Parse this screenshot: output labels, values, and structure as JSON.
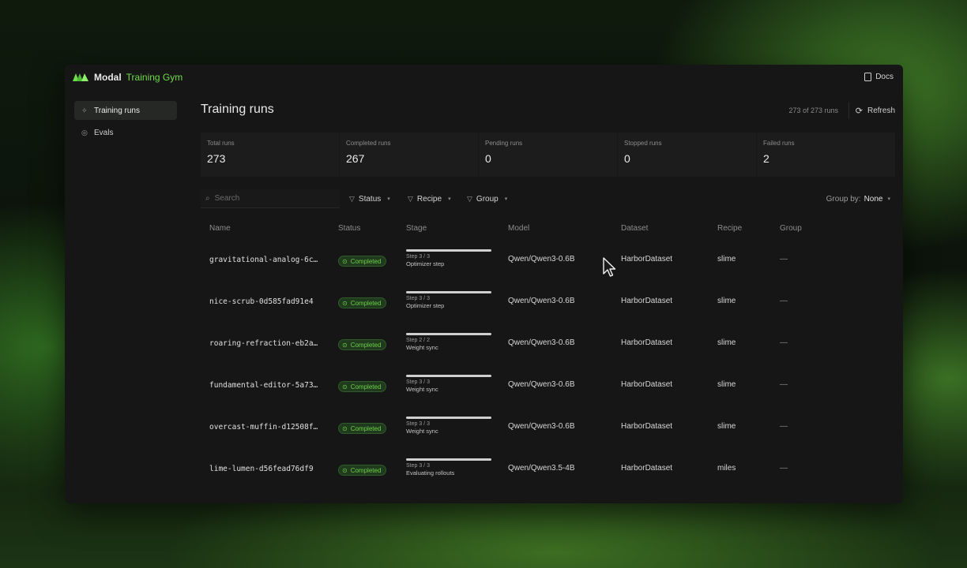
{
  "app": {
    "brand_primary": "Modal",
    "brand_secondary": "Training Gym",
    "accent_color": "#6fdc4a",
    "docs_label": "Docs"
  },
  "sidebar": {
    "items": [
      {
        "label": "Training runs",
        "icon": "sparkle-icon",
        "active": true
      },
      {
        "label": "Evals",
        "icon": "circle-check-icon",
        "active": false
      }
    ]
  },
  "header": {
    "title": "Training runs",
    "count": "273 of 273 runs",
    "refresh_label": "Refresh"
  },
  "stats": [
    {
      "label": "Total runs",
      "value": "273"
    },
    {
      "label": "Completed runs",
      "value": "267"
    },
    {
      "label": "Pending runs",
      "value": "0"
    },
    {
      "label": "Stopped runs",
      "value": "0"
    },
    {
      "label": "Failed runs",
      "value": "2"
    }
  ],
  "filters": {
    "search_placeholder": "Search",
    "chips": [
      "Status",
      "Recipe",
      "Group"
    ],
    "group_by_label": "Group by:",
    "group_by_value": "None"
  },
  "table": {
    "columns": [
      "Name",
      "Status",
      "Stage",
      "Model",
      "Dataset",
      "Recipe",
      "Group"
    ],
    "rows": [
      {
        "name": "gravitational-analog-6c…",
        "status": "Completed",
        "stage_step": "Step 3 / 3",
        "stage_label": "Optimizer step",
        "progress": 1.0,
        "model": "Qwen/Qwen3-0.6B",
        "dataset": "HarborDataset",
        "recipe": "slime",
        "group": "—"
      },
      {
        "name": "nice-scrub-0d585fad91e4",
        "status": "Completed",
        "stage_step": "Step 3 / 3",
        "stage_label": "Optimizer step",
        "progress": 1.0,
        "model": "Qwen/Qwen3-0.6B",
        "dataset": "HarborDataset",
        "recipe": "slime",
        "group": "—"
      },
      {
        "name": "roaring-refraction-eb2a…",
        "status": "Completed",
        "stage_step": "Step 2 / 2",
        "stage_label": "Weight sync",
        "progress": 1.0,
        "model": "Qwen/Qwen3-0.6B",
        "dataset": "HarborDataset",
        "recipe": "slime",
        "group": "—"
      },
      {
        "name": "fundamental-editor-5a73…",
        "status": "Completed",
        "stage_step": "Step 3 / 3",
        "stage_label": "Weight sync",
        "progress": 1.0,
        "model": "Qwen/Qwen3-0.6B",
        "dataset": "HarborDataset",
        "recipe": "slime",
        "group": "—"
      },
      {
        "name": "overcast-muffin-d12508f…",
        "status": "Completed",
        "stage_step": "Step 3 / 3",
        "stage_label": "Weight sync",
        "progress": 1.0,
        "model": "Qwen/Qwen3-0.6B",
        "dataset": "HarborDataset",
        "recipe": "slime",
        "group": "—"
      },
      {
        "name": "lime-lumen-d56fead76df9",
        "status": "Completed",
        "stage_step": "Step 3 / 3",
        "stage_label": "Evaluating rollouts",
        "progress": 1.0,
        "model": "Qwen/Qwen3.5-4B",
        "dataset": "HarborDataset",
        "recipe": "miles",
        "group": "—"
      }
    ]
  }
}
